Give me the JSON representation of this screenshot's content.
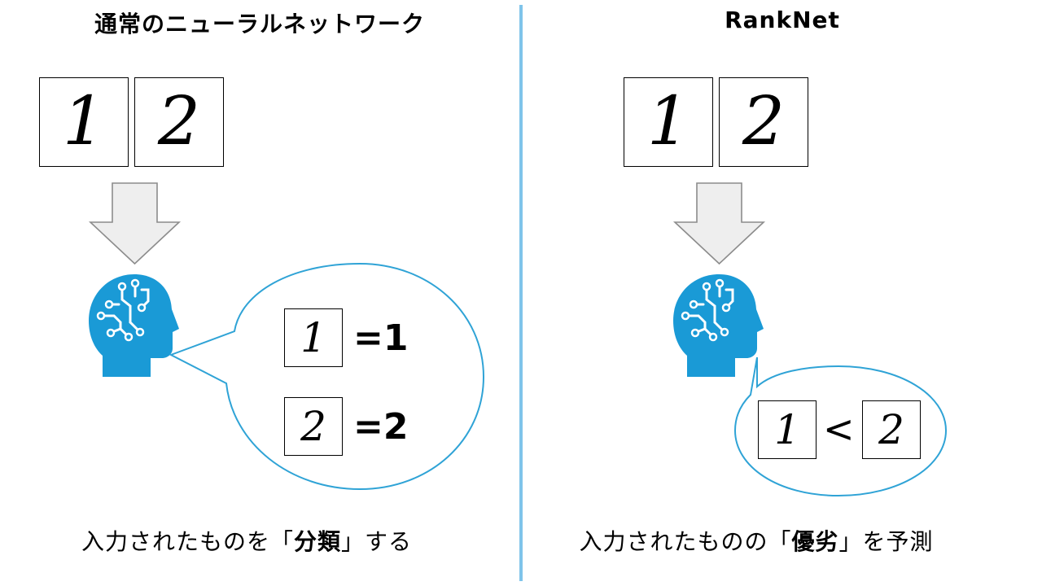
{
  "left": {
    "title": "通常のニューラルネットワーク",
    "input_digits": [
      "1",
      "2"
    ],
    "output": [
      {
        "digit": "1",
        "label": "=1"
      },
      {
        "digit": "2",
        "label": "=2"
      }
    ],
    "caption": {
      "before": "入力されたものを",
      "open_bracket": "「",
      "bold": "分類",
      "close_bracket": "」",
      "after": "する"
    }
  },
  "right": {
    "title": "RankNet",
    "input_digits": [
      "1",
      "2"
    ],
    "comparison": {
      "left_digit": "1",
      "operator": "<",
      "right_digit": "2"
    },
    "caption": {
      "before": "入力されたものの",
      "open_bracket": "「",
      "bold": "優劣",
      "close_bracket": "」",
      "after": "を予測"
    }
  },
  "colors": {
    "head_icon": "#1a9ad6",
    "bubble_stroke": "#2fa3d6",
    "arrow_fill": "#eeeeee",
    "arrow_stroke": "#8c8c8c",
    "divider": "#7fc4ea"
  },
  "icons": [
    "down-arrow-icon",
    "ai-head-icon",
    "speech-bubble-icon"
  ]
}
